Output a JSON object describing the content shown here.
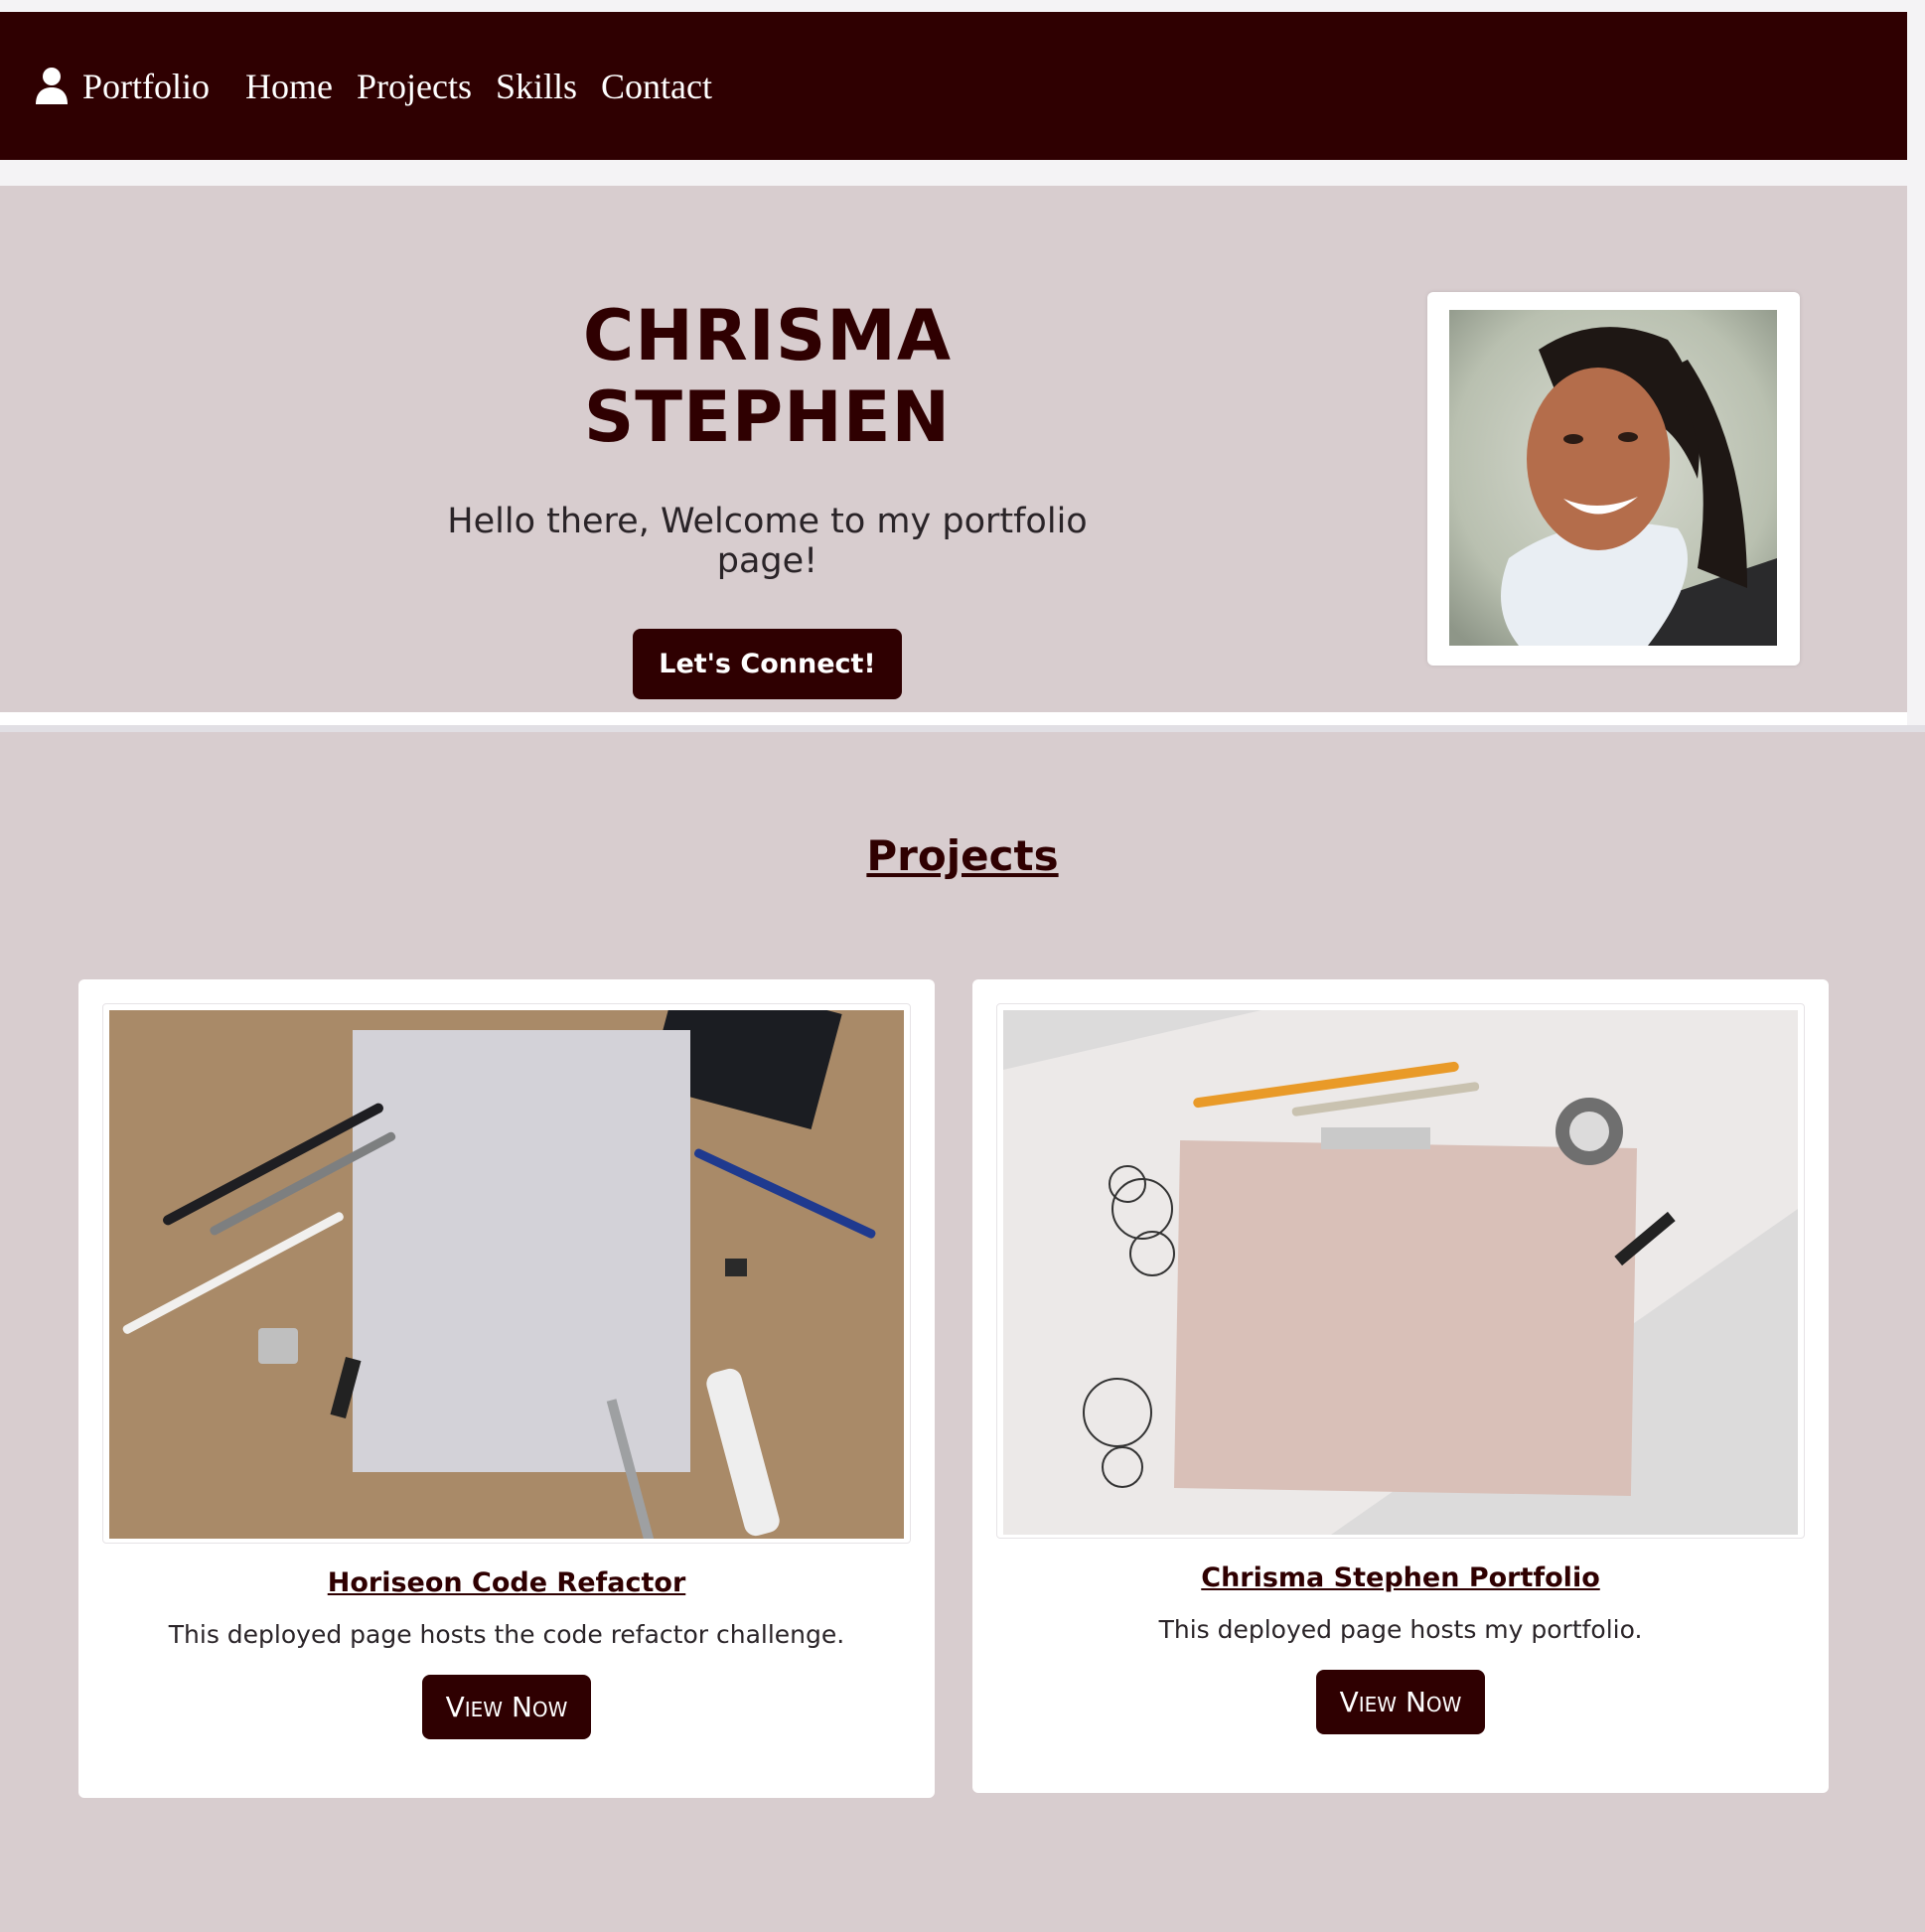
{
  "nav": {
    "brand": "Portfolio",
    "links": [
      "Home",
      "Projects",
      "Skills",
      "Contact"
    ]
  },
  "hero": {
    "name": "CHRISMA STEPHEN",
    "welcome": "Hello there, Welcome to my portfolio page!",
    "cta": "Let's Connect!"
  },
  "projects": {
    "heading": "Projects",
    "cards": [
      {
        "title": "Horiseon Code Refactor",
        "description": "This deployed page hosts the code refactor challenge.",
        "button": "View Now"
      },
      {
        "title": "Chrisma Stephen Portfolio",
        "description": "This deployed page hosts my portfolio.",
        "button": "View Now"
      }
    ]
  },
  "colors": {
    "brand": "#2f0001",
    "section_bg": "#d8cdcf",
    "card_bg": "#ffffff"
  },
  "icons": {
    "brand": "user-icon"
  }
}
